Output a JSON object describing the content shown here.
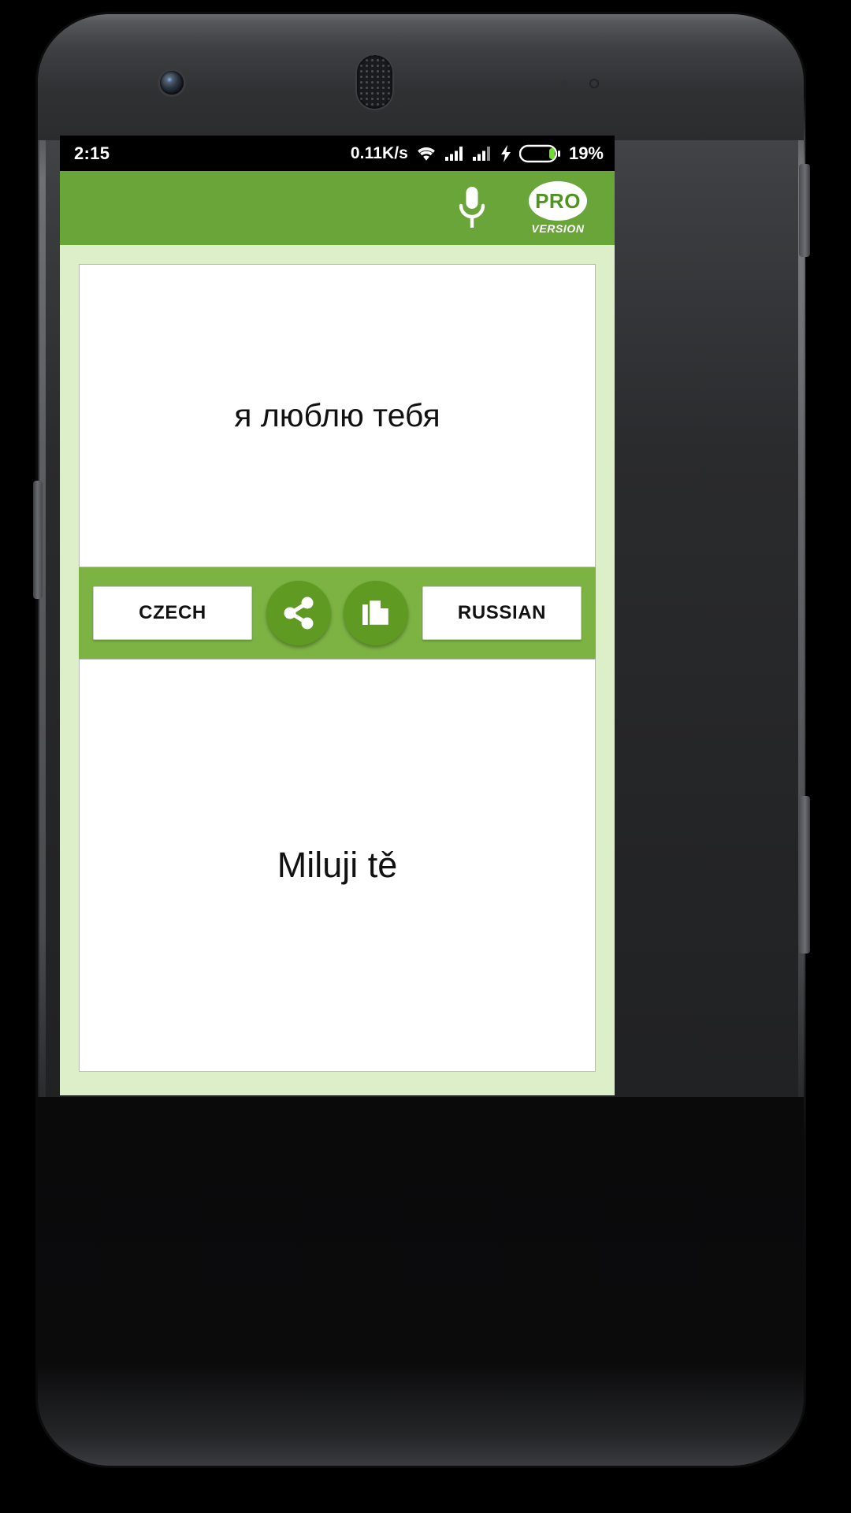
{
  "statusbar": {
    "clock": "2:15",
    "network_speed": "0.11K/s",
    "battery_percent": "19%",
    "icons": [
      "wifi-icon",
      "signal-icon",
      "signal-icon",
      "charging-bolt-icon",
      "battery-icon"
    ]
  },
  "appbar": {
    "background_color": "#6aa539",
    "mic_icon": "microphone-icon",
    "pro": {
      "title": "PRO",
      "subtitle": "VERSION"
    }
  },
  "translator": {
    "source_text": "я люблю тебя",
    "target_text": "Miluji tě",
    "source_language_label": "RUSSIAN",
    "target_language_label": "CZECH",
    "share_icon": "share-icon",
    "copy_icon": "copy-icon",
    "accent_color": "#7cb342",
    "page_background": "#dcefc8"
  }
}
